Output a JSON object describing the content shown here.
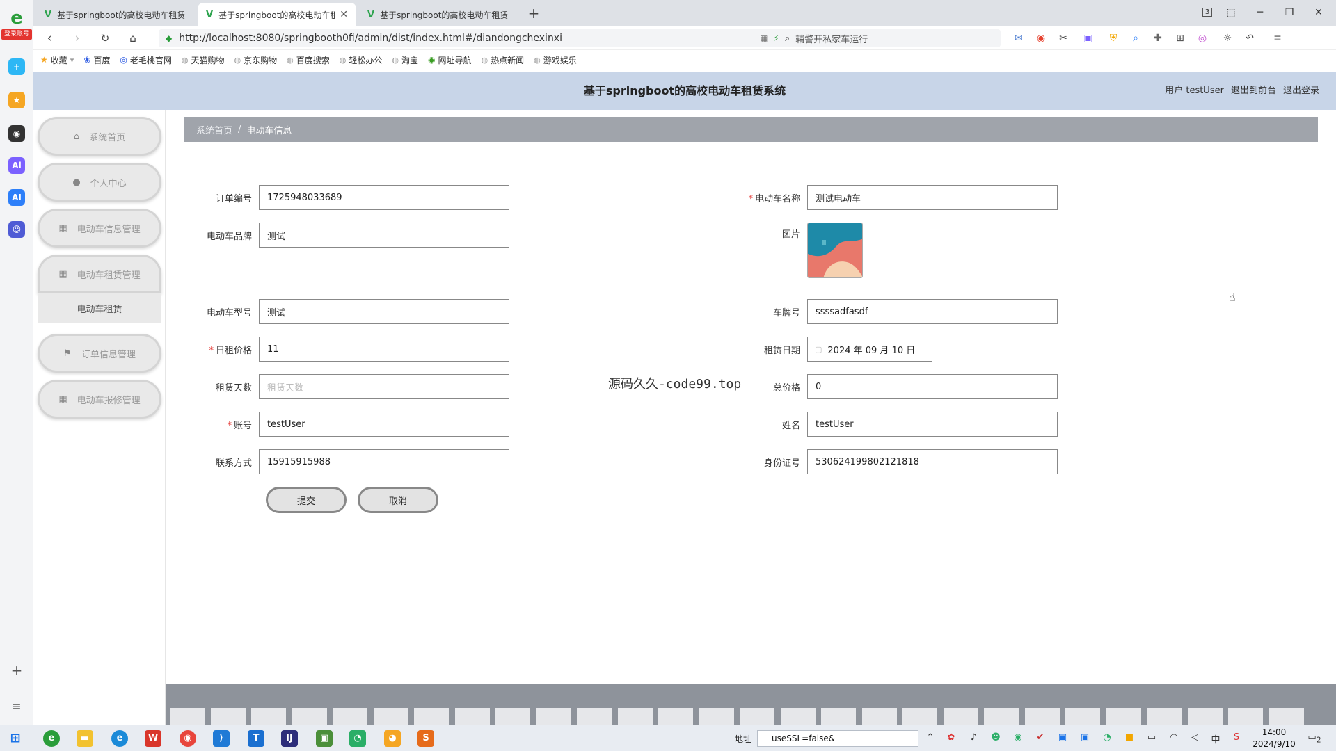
{
  "browser": {
    "tabs": [
      {
        "title": "基于springboot的高校电动车租赁系统"
      },
      {
        "title": "基于springboot的高校电动车租赁系统"
      },
      {
        "title": "基于springboot的高校电动车租赁系统"
      }
    ],
    "login_badge": "登录账号",
    "url": "http://localhost:8080/springbooth0fi/admin/dist/index.html#/diandongchexinxi",
    "search_placeholder": "辅警开私家车运行",
    "tab_count": "3",
    "bookmarks": [
      "收藏",
      "百度",
      "老毛桃官网",
      "天猫购物",
      "京东购物",
      "百度搜索",
      "轻松办公",
      "淘宝",
      "网址导航",
      "热点新闻",
      "游戏娱乐"
    ]
  },
  "header": {
    "title": "基于springboot的高校电动车租赁系统",
    "user_label": "用户 testUser",
    "front_link": "退出到前台",
    "logout_link": "退出登录"
  },
  "sidebar": {
    "items": [
      {
        "label": "系统首页",
        "icon": "home-icon"
      },
      {
        "label": "个人中心",
        "icon": "user-icon"
      },
      {
        "label": "电动车信息管理",
        "icon": "grid-icon"
      },
      {
        "label": "电动车租赁管理",
        "icon": "grid-icon"
      },
      {
        "label": "订单信息管理",
        "icon": "flag-icon"
      },
      {
        "label": "电动车报修管理",
        "icon": "grid-icon"
      }
    ],
    "submenu_item": "电动车租赁"
  },
  "breadcrumb": {
    "home": "系统首页",
    "separator": "/",
    "current": "电动车信息"
  },
  "form": {
    "order_no": {
      "label": "订单编号",
      "value": "1725948033689"
    },
    "name": {
      "label": "电动车名称",
      "value": "测试电动车"
    },
    "brand": {
      "label": "电动车品牌",
      "value": "测试"
    },
    "picture": {
      "label": "图片"
    },
    "model": {
      "label": "电动车型号",
      "value": "测试"
    },
    "plate": {
      "label": "车牌号",
      "value": "ssssadfasdf"
    },
    "daily_price": {
      "label": "日租价格",
      "value": "11"
    },
    "rent_date": {
      "label": "租赁日期",
      "value": "2024 年 09 月 10 日"
    },
    "days": {
      "label": "租赁天数",
      "placeholder": "租赁天数"
    },
    "total": {
      "label": "总价格",
      "value": "0"
    },
    "account": {
      "label": "账号",
      "value": "testUser"
    },
    "realname": {
      "label": "姓名",
      "value": "testUser"
    },
    "phone": {
      "label": "联系方式",
      "value": "15915915988"
    },
    "idcard": {
      "label": "身份证号",
      "value": "530624199802121818"
    },
    "submit": "提交",
    "cancel": "取消",
    "required_mark": "*"
  },
  "watermark": "源码久久-code99.top",
  "taskbar": {
    "addr_label": "地址",
    "addr_value": "useSSL=false&",
    "ime": "中",
    "time": "14:00",
    "date": "2024/9/10",
    "notif_count": "2"
  },
  "colors": {
    "header_bg": "#c8d5e8",
    "breadcrumb_bg": "#a0a4ab",
    "required": "#e53935",
    "tab_accent": "#2ea44f"
  }
}
